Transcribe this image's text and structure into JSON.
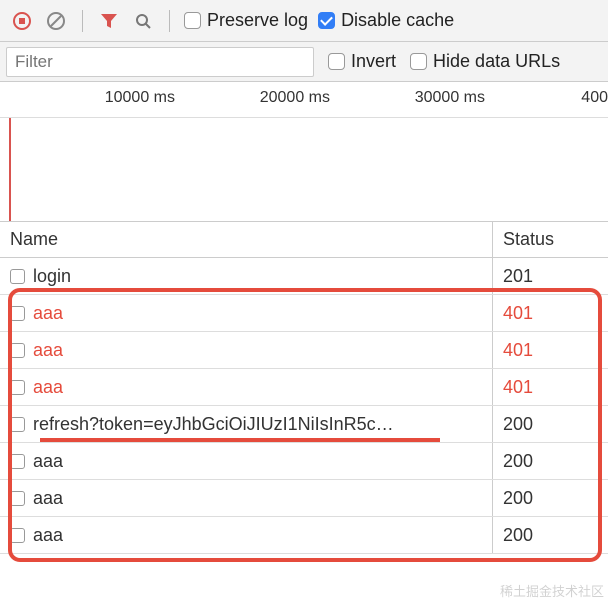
{
  "toolbar": {
    "preserve_log_label": "Preserve log",
    "disable_cache_label": "Disable cache",
    "preserve_log_checked": false,
    "disable_cache_checked": true
  },
  "filter": {
    "placeholder": "Filter",
    "value": "",
    "invert_label": "Invert",
    "hide_data_urls_label": "Hide data URLs",
    "invert_checked": false,
    "hide_data_urls_checked": false
  },
  "timeline": {
    "ticks": [
      "10000 ms",
      "20000 ms",
      "30000 ms",
      "400"
    ]
  },
  "columns": {
    "name": "Name",
    "status": "Status"
  },
  "requests": [
    {
      "name": "login",
      "status": "201",
      "error": false
    },
    {
      "name": "aaa",
      "status": "401",
      "error": true
    },
    {
      "name": "aaa",
      "status": "401",
      "error": true
    },
    {
      "name": "aaa",
      "status": "401",
      "error": true
    },
    {
      "name": "refresh?token=eyJhbGciOiJIUzI1NiIsInR5c…",
      "status": "200",
      "error": false
    },
    {
      "name": "aaa",
      "status": "200",
      "error": false
    },
    {
      "name": "aaa",
      "status": "200",
      "error": false
    },
    {
      "name": "aaa",
      "status": "200",
      "error": false
    }
  ],
  "watermark": "稀土掘金技术社区"
}
